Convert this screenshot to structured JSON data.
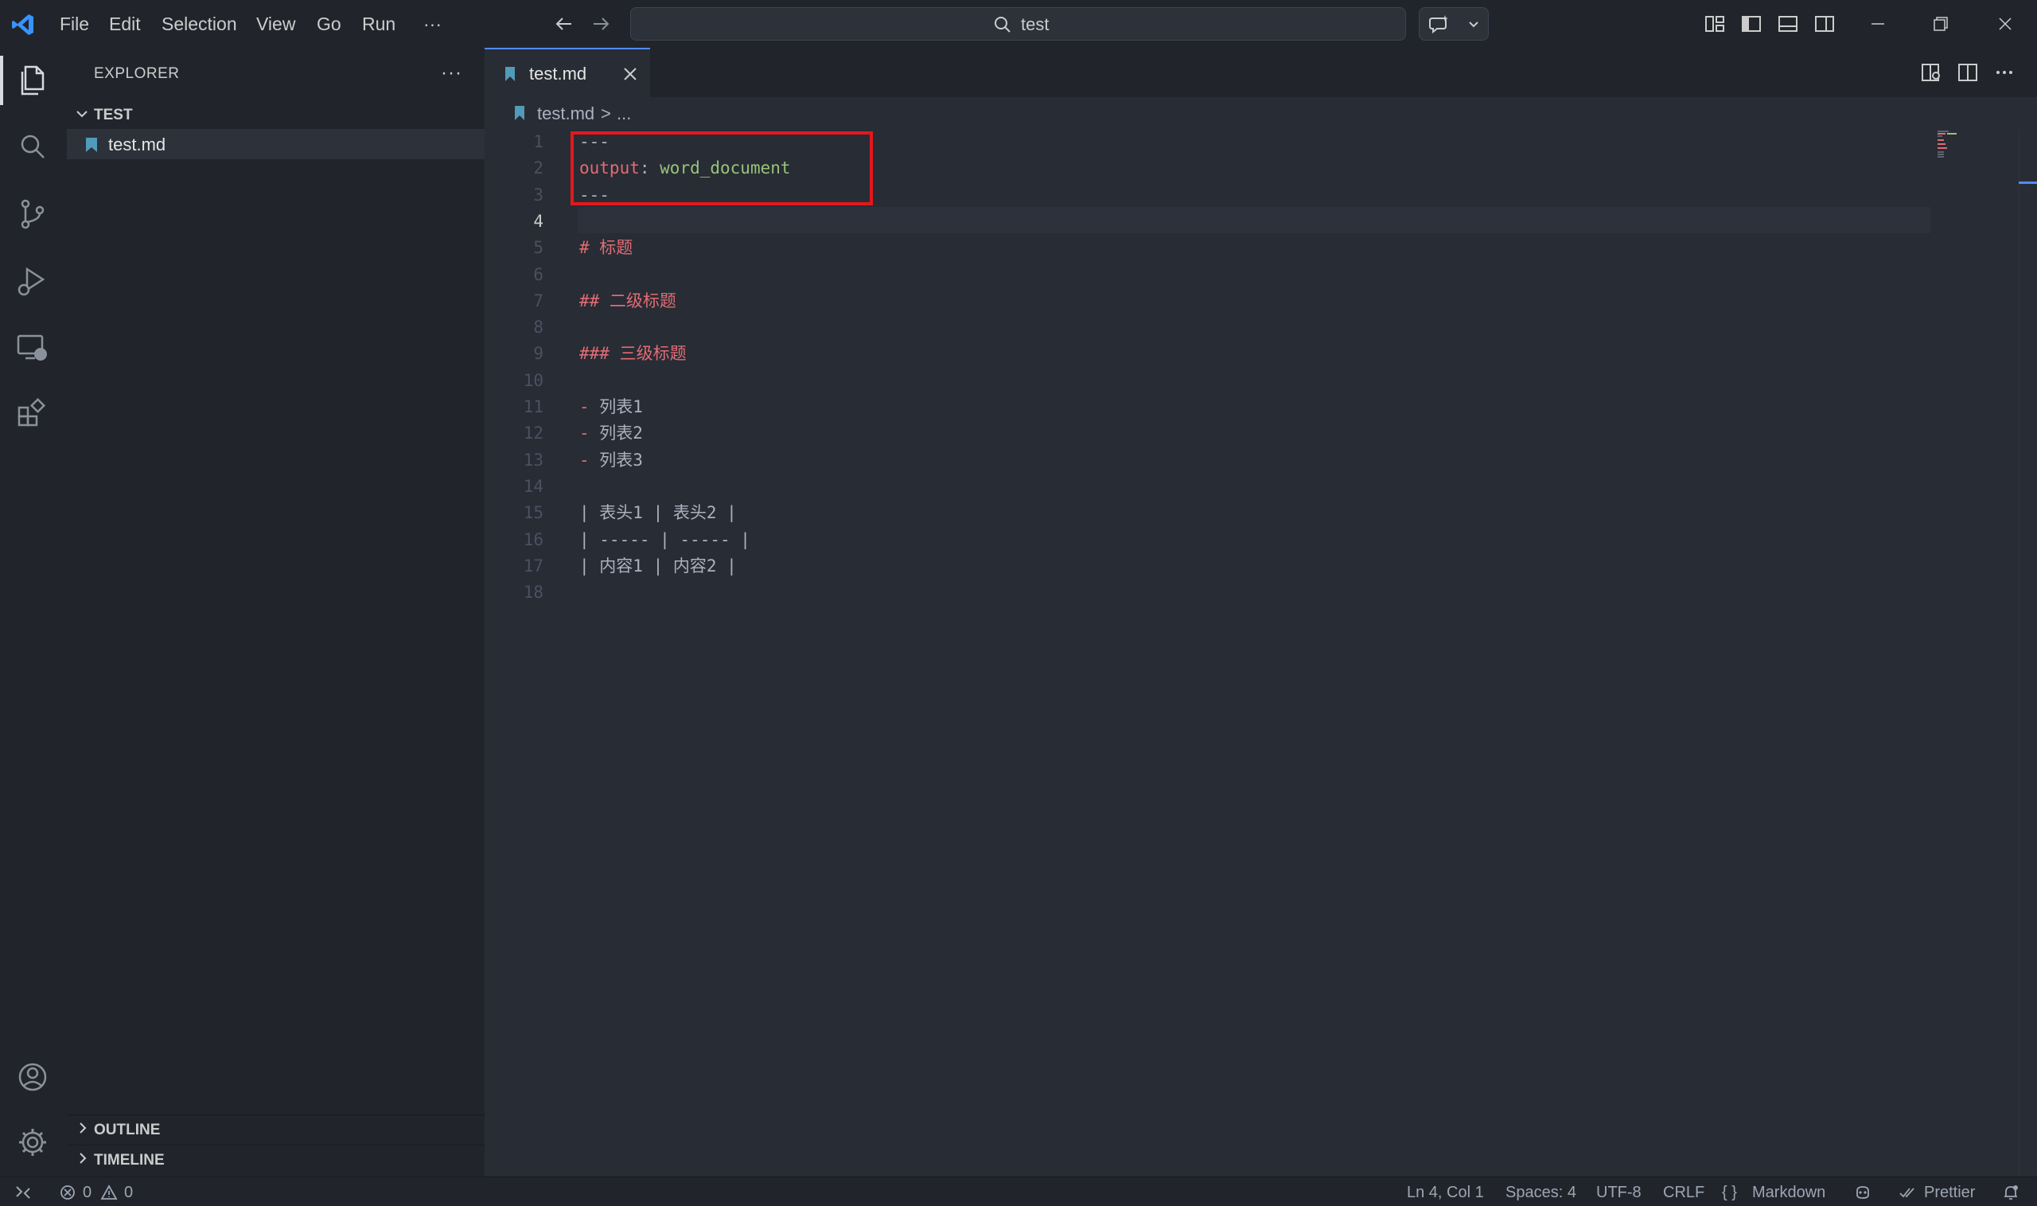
{
  "titlebar": {
    "menu": [
      "File",
      "Edit",
      "Selection",
      "View",
      "Go",
      "Run",
      "···"
    ],
    "search_text": "test"
  },
  "sidebar": {
    "title": "EXPLORER",
    "more": "···",
    "folder": "TEST",
    "file": "test.md",
    "sections": [
      "OUTLINE",
      "TIMELINE"
    ]
  },
  "tab": {
    "label": "test.md"
  },
  "breadcrumb": {
    "file": "test.md",
    "separator": ">",
    "more": "..."
  },
  "editor": {
    "current_line": 4,
    "lines": [
      {
        "no": "1",
        "parts": [
          {
            "t": "---",
            "c": "plain"
          }
        ]
      },
      {
        "no": "2",
        "parts": [
          {
            "t": "output",
            "c": "key"
          },
          {
            "t": ": ",
            "c": "plain"
          },
          {
            "t": "word_document",
            "c": "str"
          }
        ]
      },
      {
        "no": "3",
        "parts": [
          {
            "t": "---",
            "c": "plain"
          }
        ]
      },
      {
        "no": "4",
        "parts": []
      },
      {
        "no": "5",
        "parts": [
          {
            "t": "# 标题",
            "c": "heading"
          }
        ]
      },
      {
        "no": "6",
        "parts": []
      },
      {
        "no": "7",
        "parts": [
          {
            "t": "## 二级标题",
            "c": "heading"
          }
        ]
      },
      {
        "no": "8",
        "parts": []
      },
      {
        "no": "9",
        "parts": [
          {
            "t": "### 三级标题",
            "c": "heading"
          }
        ]
      },
      {
        "no": "10",
        "parts": []
      },
      {
        "no": "11",
        "parts": [
          {
            "t": "- ",
            "c": "heading"
          },
          {
            "t": "列表1",
            "c": "plain"
          }
        ]
      },
      {
        "no": "12",
        "parts": [
          {
            "t": "- ",
            "c": "heading"
          },
          {
            "t": "列表2",
            "c": "plain"
          }
        ]
      },
      {
        "no": "13",
        "parts": [
          {
            "t": "- ",
            "c": "heading"
          },
          {
            "t": "列表3",
            "c": "plain"
          }
        ]
      },
      {
        "no": "14",
        "parts": []
      },
      {
        "no": "15",
        "parts": [
          {
            "t": "| 表头1 | 表头2 |",
            "c": "plain"
          }
        ]
      },
      {
        "no": "16",
        "parts": [
          {
            "t": "| ----- | ----- |",
            "c": "plain"
          }
        ]
      },
      {
        "no": "17",
        "parts": [
          {
            "t": "| 内容1 | 内容2 |",
            "c": "plain"
          }
        ]
      },
      {
        "no": "18",
        "parts": []
      }
    ]
  },
  "statusbar": {
    "errors": "0",
    "warnings": "0",
    "position": "Ln 4, Col 1",
    "spaces": "Spaces: 4",
    "encoding": "UTF-8",
    "eol": "CRLF",
    "language_braces": "{ }",
    "language": "Markdown",
    "prettier": "Prettier"
  },
  "colors": {
    "accent": "#528bff",
    "highlight_box": "#e5171c",
    "md_icon": "#519aba"
  }
}
